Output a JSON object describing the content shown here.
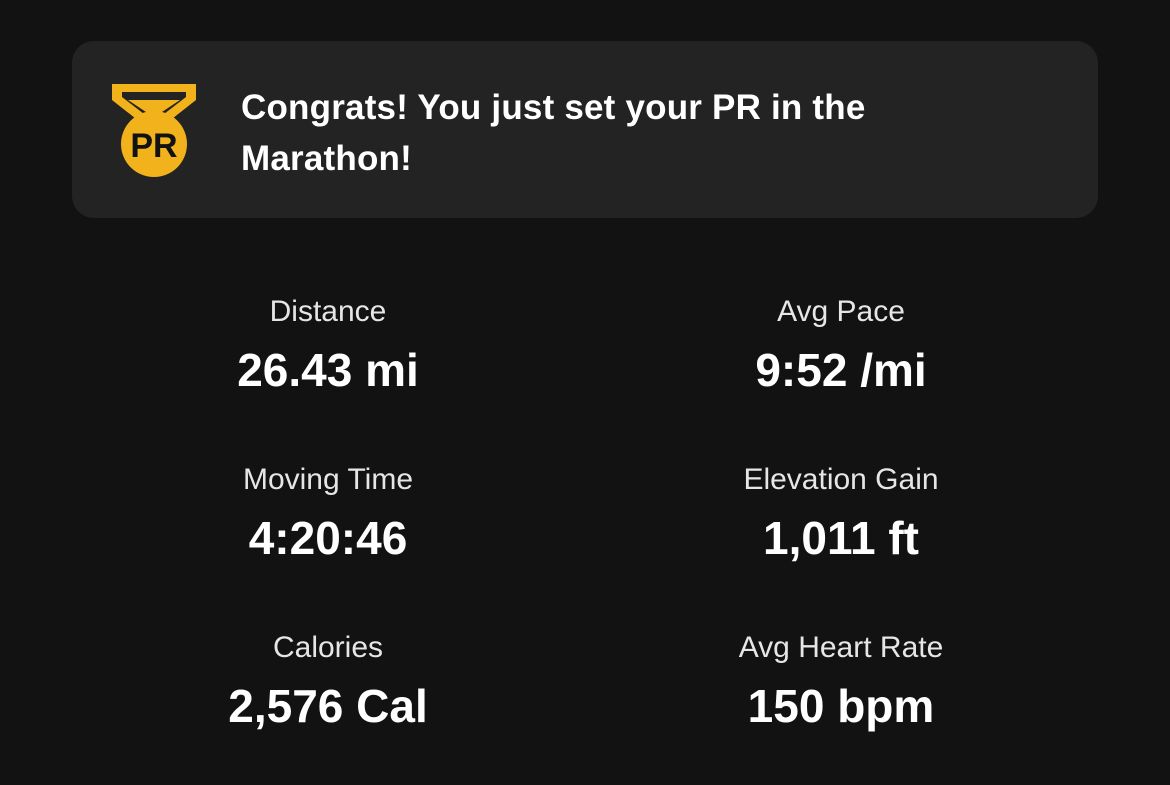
{
  "banner": {
    "badge_text": "PR",
    "message": "Congrats! You just set your PR in the Marathon!",
    "accent_color": "#f2b21c",
    "icon": "pr-medal-icon"
  },
  "stats": {
    "distance": {
      "label": "Distance",
      "value": "26.43 mi"
    },
    "avg_pace": {
      "label": "Avg Pace",
      "value": "9:52 /mi"
    },
    "moving_time": {
      "label": "Moving Time",
      "value": "4:20:46"
    },
    "elevation_gain": {
      "label": "Elevation Gain",
      "value": "1,011 ft"
    },
    "calories": {
      "label": "Calories",
      "value": "2,576 Cal"
    },
    "avg_heart_rate": {
      "label": "Avg Heart Rate",
      "value": "150 bpm"
    }
  }
}
